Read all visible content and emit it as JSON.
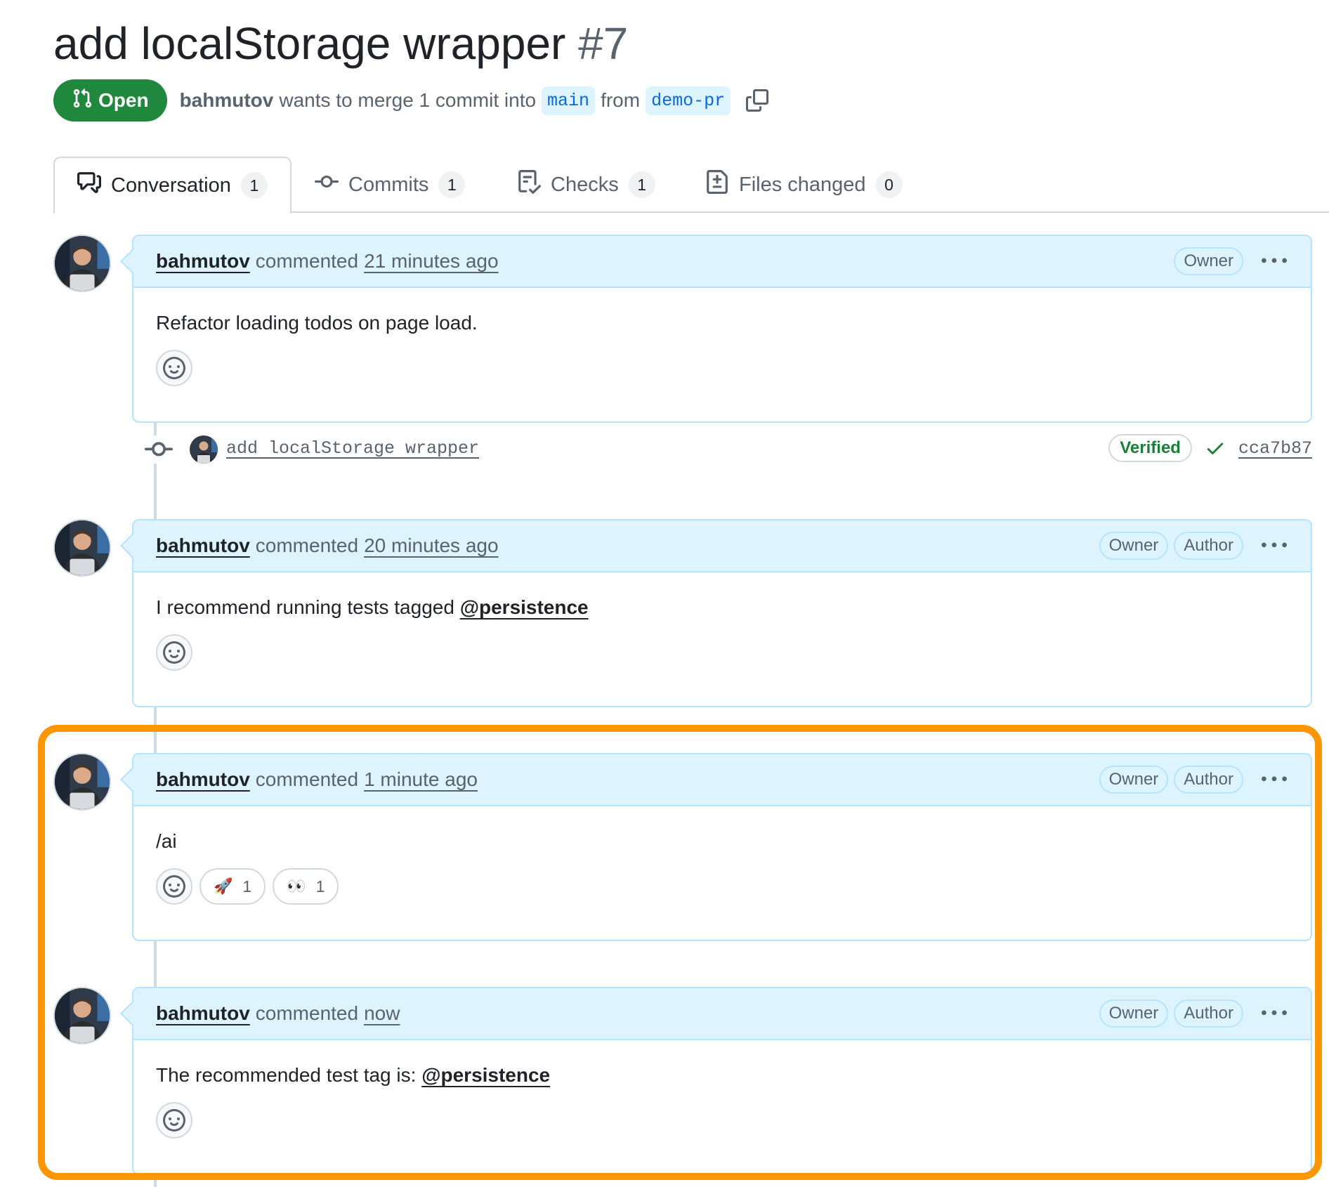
{
  "pr": {
    "title": "add localStorage wrapper",
    "number": "#7",
    "state": "Open",
    "author": "bahmutov",
    "merge_text": "wants to merge 1 commit into",
    "base_branch": "main",
    "from_text": "from",
    "head_branch": "demo-pr"
  },
  "tabs": [
    {
      "label": "Conversation",
      "count": "1",
      "icon": "comment-discussion-icon",
      "active": true
    },
    {
      "label": "Commits",
      "count": "1",
      "icon": "git-commit-icon",
      "active": false
    },
    {
      "label": "Checks",
      "count": "1",
      "icon": "checklist-icon",
      "active": false
    },
    {
      "label": "Files changed",
      "count": "0",
      "icon": "file-diff-icon",
      "active": false
    }
  ],
  "comments": [
    {
      "author": "bahmutov",
      "action": "commented",
      "time": "21 minutes ago",
      "labels": [
        "Owner"
      ],
      "body_text": "Refactor loading todos on page load.",
      "mention": ""
    },
    {
      "author": "bahmutov",
      "action": "commented",
      "time": "20 minutes ago",
      "labels": [
        "Owner",
        "Author"
      ],
      "body_text": "I recommend running tests tagged ",
      "mention": "@persistence"
    },
    {
      "author": "bahmutov",
      "action": "commented",
      "time": "1 minute ago",
      "labels": [
        "Owner",
        "Author"
      ],
      "body_text": "/ai",
      "mention": "",
      "reactions": [
        {
          "emoji": "🚀",
          "count": "1",
          "icon": "rocket-icon"
        },
        {
          "emoji": "👀",
          "count": "1",
          "icon": "eyes-icon"
        }
      ]
    },
    {
      "author": "bahmutov",
      "action": "commented",
      "time": "now",
      "labels": [
        "Owner",
        "Author"
      ],
      "body_text": "The recommended test tag is: ",
      "mention": "@persistence"
    }
  ],
  "commit": {
    "message": "add localStorage wrapper",
    "verified": "Verified",
    "sha": "cca7b87"
  },
  "colors": {
    "open_green": "#1f883d",
    "header_blue": "#ddf4ff",
    "border_blue": "#b6e3ff",
    "highlight_orange": "#fb9600",
    "link_blue": "#0969da"
  }
}
